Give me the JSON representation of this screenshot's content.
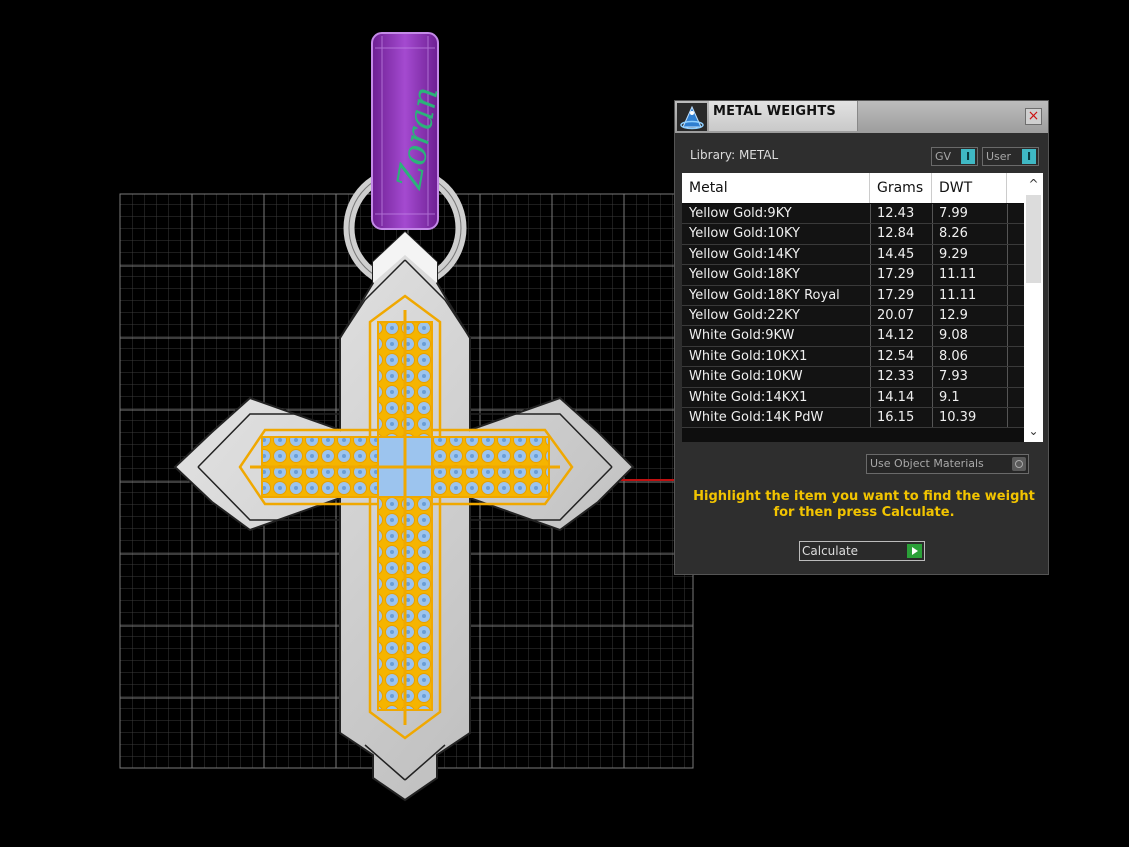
{
  "panel": {
    "title": "METAL WEIGHTS",
    "close_glyph": "×",
    "library_label": "Library: METAL",
    "gv_toggle": {
      "label": "GV",
      "state": "I"
    },
    "user_toggle": {
      "label": "User",
      "state": "I"
    },
    "table": {
      "headers": [
        "Metal",
        "Grams",
        "DWT"
      ],
      "rows": [
        {
          "metal": "Yellow Gold:9KY",
          "grams": "12.43",
          "dwt": "7.99"
        },
        {
          "metal": "Yellow Gold:10KY",
          "grams": "12.84",
          "dwt": "8.26"
        },
        {
          "metal": "Yellow Gold:14KY",
          "grams": "14.45",
          "dwt": "9.29"
        },
        {
          "metal": "Yellow Gold:18KY",
          "grams": "17.29",
          "dwt": "11.11"
        },
        {
          "metal": "Yellow Gold:18KY Royal",
          "grams": "17.29",
          "dwt": "11.11"
        },
        {
          "metal": "Yellow Gold:22KY",
          "grams": "20.07",
          "dwt": "12.9"
        },
        {
          "metal": "White Gold:9KW",
          "grams": "14.12",
          "dwt": "9.08"
        },
        {
          "metal": "White Gold:10KX1",
          "grams": "12.54",
          "dwt": "8.06"
        },
        {
          "metal": "White Gold:10KW",
          "grams": "12.33",
          "dwt": "7.93"
        },
        {
          "metal": "White Gold:14KX1",
          "grams": "14.14",
          "dwt": "9.1"
        },
        {
          "metal": "White Gold:14K PdW",
          "grams": "16.15",
          "dwt": "10.39"
        }
      ]
    },
    "use_object_materials": "Use Object Materials",
    "instructions": "Highlight the item you want to find the weight for then press Calculate.",
    "calculate_label": "Calculate"
  },
  "viewport": {
    "bail_engraving": "Zoran"
  },
  "colors": {
    "accent_yellow": "#f2c400",
    "toggle_teal": "#3fb8c4",
    "bail_purple": "#8a2bb5",
    "gem_blue": "#8ab8e8",
    "cross_orange": "#f0a800"
  },
  "icons": [
    "app-logo-icon",
    "close-icon",
    "scroll-up-icon",
    "scroll-down-icon",
    "play-icon"
  ]
}
